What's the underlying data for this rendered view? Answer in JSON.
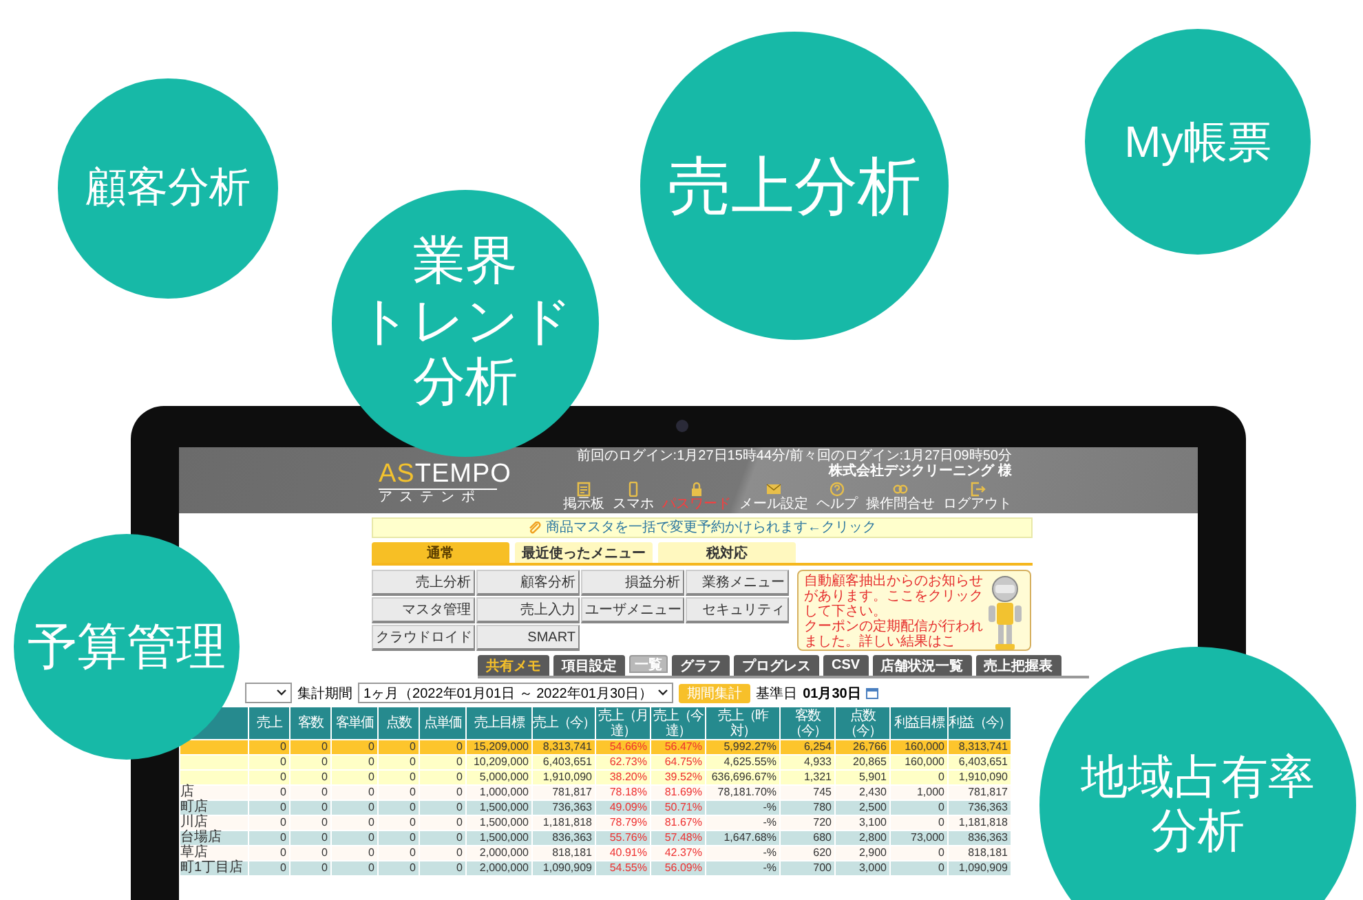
{
  "bubbles": [
    {
      "lines": [
        "顧客分析"
      ]
    },
    {
      "lines": [
        "業界",
        "トレンド",
        "分析"
      ]
    },
    {
      "lines": [
        "売上分析"
      ]
    },
    {
      "lines": [
        "My帳票"
      ]
    },
    {
      "lines": [
        "予算管理"
      ]
    },
    {
      "lines": [
        "地域占有率",
        "分析"
      ]
    }
  ],
  "header": {
    "logo": {
      "accent": "AS",
      "rest": "TEMPO",
      "sub": "アステンポ"
    },
    "last_login": "前回のログイン:1月27日15時44分/前々回のログイン:1月27日09時50分",
    "company": "株式会社デジクリーニング 様",
    "nav": [
      {
        "label": "掲示板",
        "kind": "board",
        "highlighted": false
      },
      {
        "label": "スマホ",
        "kind": "phone",
        "highlighted": false
      },
      {
        "label": "パスワード",
        "kind": "lock",
        "highlighted": true
      },
      {
        "label": "メール設定",
        "kind": "mail",
        "highlighted": false
      },
      {
        "label": "ヘルプ",
        "kind": "help",
        "highlighted": false
      },
      {
        "label": "操作問合せ",
        "kind": "contact",
        "highlighted": false
      },
      {
        "label": "ログアウト",
        "kind": "logout",
        "highlighted": false
      }
    ]
  },
  "notice_bar": "商品マスタを一括で変更予約かけられます←クリック",
  "tabs": [
    {
      "label": "通常",
      "selected": true
    },
    {
      "label": "最近使ったメニュー",
      "selected": false
    },
    {
      "label": "税対応",
      "selected": false
    }
  ],
  "menu_buttons": [
    "売上分析",
    "顧客分析",
    "損益分析",
    "業務メニュー",
    "マスタ管理",
    "売上入力",
    "ユーザメニュー",
    "セキュリティ",
    "クラウドロイド",
    "SMART"
  ],
  "info_box": [
    "自動顧客抽出からのお知らせがあります。ここをクリックして下さい。",
    "クーポンの定期配信が行われました。詳しい結果はこ"
  ],
  "view_buttons": [
    {
      "label": "共有メモ",
      "kind": "memo",
      "selected": false
    },
    {
      "label": "項目設定",
      "kind": "normal",
      "selected": false
    },
    {
      "label": "一覧",
      "kind": "normal",
      "selected": true
    },
    {
      "label": "グラフ",
      "kind": "normal",
      "selected": false
    },
    {
      "label": "プログレス",
      "kind": "normal",
      "selected": false
    },
    {
      "label": "CSV",
      "kind": "normal",
      "selected": false
    },
    {
      "label": "店舗状況一覧",
      "kind": "normal",
      "selected": false
    },
    {
      "label": "売上把握表",
      "kind": "normal",
      "selected": false
    }
  ],
  "filter": {
    "period_label": "集計期間",
    "period_value": "1ヶ月（2022年01月01日 ～ 2022年01月30日）",
    "button": "期間集計",
    "base_date_label": "基準日",
    "base_date": "01月30日"
  },
  "table": {
    "columns": [
      {
        "label": "売上",
        "kind": "num"
      },
      {
        "label": "客数",
        "kind": "num"
      },
      {
        "label": "客単価",
        "kind": "num"
      },
      {
        "label": "点数",
        "kind": "num"
      },
      {
        "label": "点単価",
        "kind": "num"
      },
      {
        "label": "売上目標",
        "kind": "num"
      },
      {
        "label": "売上（今）",
        "kind": "num"
      },
      {
        "label": "売上（月達）",
        "kind": "rate"
      },
      {
        "label": "売上（今達）",
        "kind": "rate"
      },
      {
        "label": "売上（昨対）",
        "kind": "num"
      },
      {
        "label": "客数（今）",
        "kind": "num"
      },
      {
        "label": "点数（今）",
        "kind": "num"
      },
      {
        "label": "利益目標",
        "kind": "num"
      },
      {
        "label": "利益（今）",
        "kind": "num"
      }
    ],
    "rows": [
      {
        "kind": "total",
        "cells": [
          "0",
          "0",
          "0",
          "0",
          "0",
          "15,209,000",
          "8,313,741",
          "54.66%",
          "56.47%",
          "5,992.27%",
          "6,254",
          "26,766",
          "160,000",
          "8,313,741"
        ]
      },
      {
        "kind": "subtotal",
        "cells": [
          "0",
          "0",
          "0",
          "0",
          "0",
          "10,209,000",
          "6,403,651",
          "62.73%",
          "64.75%",
          "4,625.55%",
          "4,933",
          "20,865",
          "160,000",
          "6,403,651"
        ]
      },
      {
        "kind": "subtotal",
        "cells": [
          "0",
          "0",
          "0",
          "0",
          "0",
          "5,000,000",
          "1,910,090",
          "38.20%",
          "39.52%",
          "636,696.67%",
          "1,321",
          "5,901",
          "0",
          "1,910,090"
        ]
      },
      {
        "kind": "store",
        "name": "店",
        "cells": [
          "0",
          "0",
          "0",
          "0",
          "0",
          "1,000,000",
          "781,817",
          "78.18%",
          "81.69%",
          "78,181.70%",
          "745",
          "2,430",
          "1,000",
          "781,817"
        ]
      },
      {
        "kind": "store",
        "name": "町店",
        "cells": [
          "0",
          "0",
          "0",
          "0",
          "0",
          "1,500,000",
          "736,363",
          "49.09%",
          "50.71%",
          "-%",
          "780",
          "2,500",
          "0",
          "736,363"
        ]
      },
      {
        "kind": "store",
        "name": "川店",
        "cells": [
          "0",
          "0",
          "0",
          "0",
          "0",
          "1,500,000",
          "1,181,818",
          "78.79%",
          "81.67%",
          "-%",
          "720",
          "3,100",
          "0",
          "1,181,818"
        ]
      },
      {
        "kind": "store",
        "name": "台場店",
        "cells": [
          "0",
          "0",
          "0",
          "0",
          "0",
          "1,500,000",
          "836,363",
          "55.76%",
          "57.48%",
          "1,647.68%",
          "680",
          "2,800",
          "73,000",
          "836,363"
        ]
      },
      {
        "kind": "store",
        "name": "草店",
        "cells": [
          "0",
          "0",
          "0",
          "0",
          "0",
          "2,000,000",
          "818,181",
          "40.91%",
          "42.37%",
          "-%",
          "620",
          "2,900",
          "0",
          "818,181"
        ]
      },
      {
        "kind": "store",
        "name": "町1丁目店",
        "cells": [
          "0",
          "0",
          "0",
          "0",
          "0",
          "2,000,000",
          "1,090,909",
          "54.55%",
          "56.09%",
          "-%",
          "700",
          "3,000",
          "0",
          "1,090,909"
        ]
      }
    ]
  }
}
